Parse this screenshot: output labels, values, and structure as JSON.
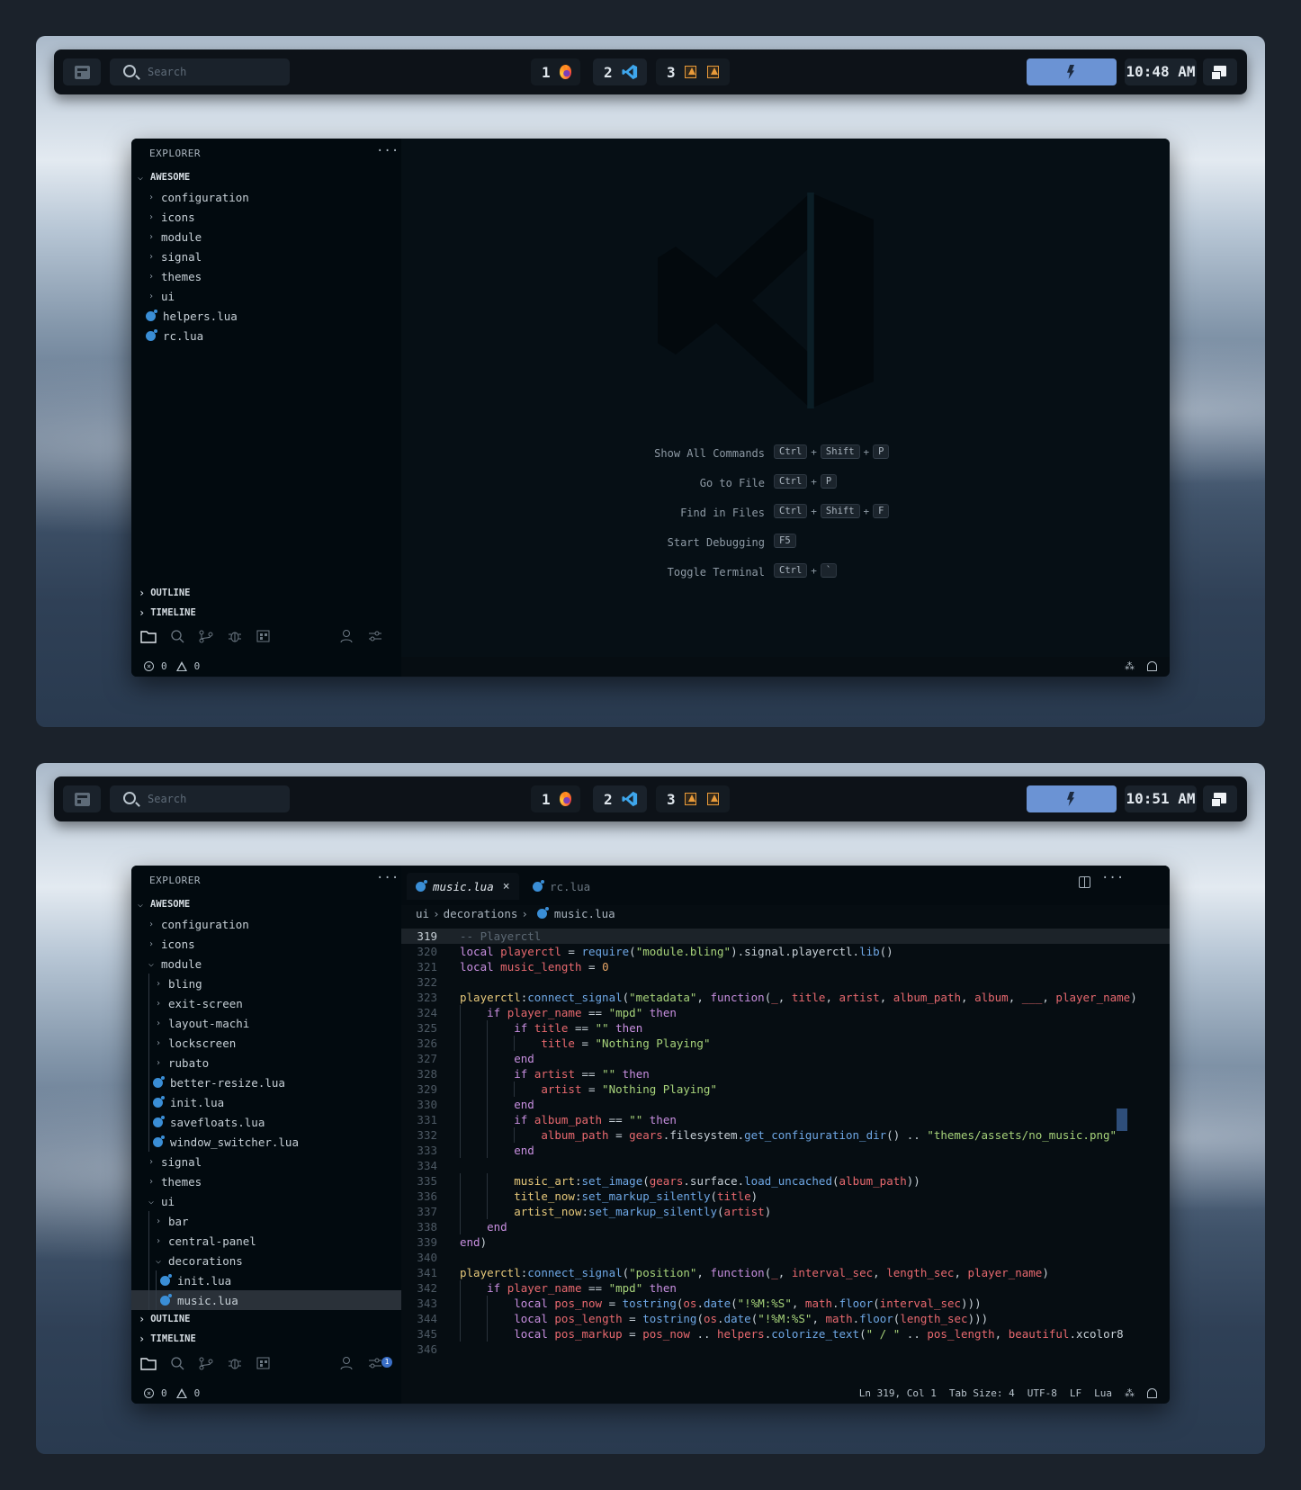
{
  "screens": [
    {
      "bar": {
        "search_placeholder": "Search",
        "workspaces": [
          "1",
          "2",
          "3"
        ],
        "time": "10:48 AM"
      },
      "explorer": {
        "header": "EXPLORER",
        "more": "···",
        "root": "AWESOME",
        "items": [
          {
            "label": "configuration",
            "kind": "folder"
          },
          {
            "label": "icons",
            "kind": "folder"
          },
          {
            "label": "module",
            "kind": "folder"
          },
          {
            "label": "signal",
            "kind": "folder"
          },
          {
            "label": "themes",
            "kind": "folder"
          },
          {
            "label": "ui",
            "kind": "folder"
          },
          {
            "label": "helpers.lua",
            "kind": "file"
          },
          {
            "label": "rc.lua",
            "kind": "file"
          }
        ],
        "outline": "OUTLINE",
        "timeline": "TIMELINE"
      },
      "status": {
        "errors": "0",
        "warnings": "0"
      },
      "welcome": {
        "hints": [
          {
            "label": "Show All Commands",
            "keys": [
              "Ctrl",
              "Shift",
              "P"
            ]
          },
          {
            "label": "Go to File",
            "keys": [
              "Ctrl",
              "P"
            ]
          },
          {
            "label": "Find in Files",
            "keys": [
              "Ctrl",
              "Shift",
              "F"
            ]
          },
          {
            "label": "Start Debugging",
            "keys": [
              "F5"
            ]
          },
          {
            "label": "Toggle Terminal",
            "keys": [
              "Ctrl",
              "`"
            ]
          }
        ]
      }
    },
    {
      "bar": {
        "search_placeholder": "Search",
        "workspaces": [
          "1",
          "2",
          "3"
        ],
        "time": "10:51 AM"
      },
      "explorer": {
        "header": "EXPLORER",
        "more": "···",
        "root": "AWESOME",
        "items": [
          {
            "label": "configuration",
            "kind": "folder",
            "depth": 0,
            "open": false
          },
          {
            "label": "icons",
            "kind": "folder",
            "depth": 0,
            "open": false
          },
          {
            "label": "module",
            "kind": "folder",
            "depth": 0,
            "open": true
          },
          {
            "label": "bling",
            "kind": "folder",
            "depth": 1,
            "open": false
          },
          {
            "label": "exit-screen",
            "kind": "folder",
            "depth": 1,
            "open": false
          },
          {
            "label": "layout-machi",
            "kind": "folder",
            "depth": 1,
            "open": false
          },
          {
            "label": "lockscreen",
            "kind": "folder",
            "depth": 1,
            "open": false
          },
          {
            "label": "rubato",
            "kind": "folder",
            "depth": 1,
            "open": false
          },
          {
            "label": "better-resize.lua",
            "kind": "file",
            "depth": 1
          },
          {
            "label": "init.lua",
            "kind": "file",
            "depth": 1
          },
          {
            "label": "savefloats.lua",
            "kind": "file",
            "depth": 1
          },
          {
            "label": "window_switcher.lua",
            "kind": "file",
            "depth": 1
          },
          {
            "label": "signal",
            "kind": "folder",
            "depth": 0,
            "open": false
          },
          {
            "label": "themes",
            "kind": "folder",
            "depth": 0,
            "open": false
          },
          {
            "label": "ui",
            "kind": "folder",
            "depth": 0,
            "open": true
          },
          {
            "label": "bar",
            "kind": "folder",
            "depth": 1,
            "open": false
          },
          {
            "label": "central-panel",
            "kind": "folder",
            "depth": 1,
            "open": false
          },
          {
            "label": "decorations",
            "kind": "folder",
            "depth": 1,
            "open": true
          },
          {
            "label": "init.lua",
            "kind": "file",
            "depth": 2
          },
          {
            "label": "music.lua",
            "kind": "file",
            "depth": 2,
            "selected": true
          }
        ],
        "outline": "OUTLINE",
        "timeline": "TIMELINE",
        "badge": "1"
      },
      "editor": {
        "tabs": [
          {
            "label": "music.lua",
            "active": true,
            "close": "×"
          },
          {
            "label": "rc.lua",
            "active": false
          }
        ],
        "breadcrumb": [
          "ui",
          "decorations",
          "music.lua"
        ],
        "current_line": 319,
        "lines": [
          {
            "n": "319",
            "text": "-- Playerctl"
          },
          {
            "n": "320",
            "text": "local playerctl = require(\"module.bling\").signal.playerctl.lib()"
          },
          {
            "n": "321",
            "text": "local music_length = 0"
          },
          {
            "n": "322",
            "text": ""
          },
          {
            "n": "323",
            "text": "playerctl:connect_signal(\"metadata\", function(_, title, artist, album_path, album, ___, player_name)"
          },
          {
            "n": "324",
            "text": "    if player_name == \"mpd\" then"
          },
          {
            "n": "325",
            "text": "        if title == \"\" then"
          },
          {
            "n": "326",
            "text": "            title = \"Nothing Playing\""
          },
          {
            "n": "327",
            "text": "        end"
          },
          {
            "n": "328",
            "text": "        if artist == \"\" then"
          },
          {
            "n": "329",
            "text": "            artist = \"Nothing Playing\""
          },
          {
            "n": "330",
            "text": "        end"
          },
          {
            "n": "331",
            "text": "        if album_path == \"\" then"
          },
          {
            "n": "332",
            "text": "            album_path = gears.filesystem.get_configuration_dir() .. \"themes/assets/no_music.png\""
          },
          {
            "n": "333",
            "text": "        end"
          },
          {
            "n": "334",
            "text": ""
          },
          {
            "n": "335",
            "text": "        music_art:set_image(gears.surface.load_uncached(album_path))"
          },
          {
            "n": "336",
            "text": "        title_now:set_markup_silently(title)"
          },
          {
            "n": "337",
            "text": "        artist_now:set_markup_silently(artist)"
          },
          {
            "n": "338",
            "text": "    end"
          },
          {
            "n": "339",
            "text": "end)"
          },
          {
            "n": "340",
            "text": ""
          },
          {
            "n": "341",
            "text": "playerctl:connect_signal(\"position\", function(_, interval_sec, length_sec, player_name)"
          },
          {
            "n": "342",
            "text": "    if player_name == \"mpd\" then"
          },
          {
            "n": "343",
            "text": "        local pos_now = tostring(os.date(\"!%M:%S\", math.floor(interval_sec)))"
          },
          {
            "n": "344",
            "text": "        local pos_length = tostring(os.date(\"!%M:%S\", math.floor(length_sec)))"
          },
          {
            "n": "345",
            "text": "        local pos_markup = pos_now .. helpers.colorize_text(\" / \" .. pos_length, beautiful.xcolor8"
          },
          {
            "n": "346",
            "text": ""
          }
        ]
      },
      "status": {
        "errors": "0",
        "warnings": "0",
        "position": "Ln 319, Col 1",
        "tab_size": "Tab Size: 4",
        "encoding": "UTF-8",
        "eol": "LF",
        "language": "Lua"
      }
    }
  ]
}
